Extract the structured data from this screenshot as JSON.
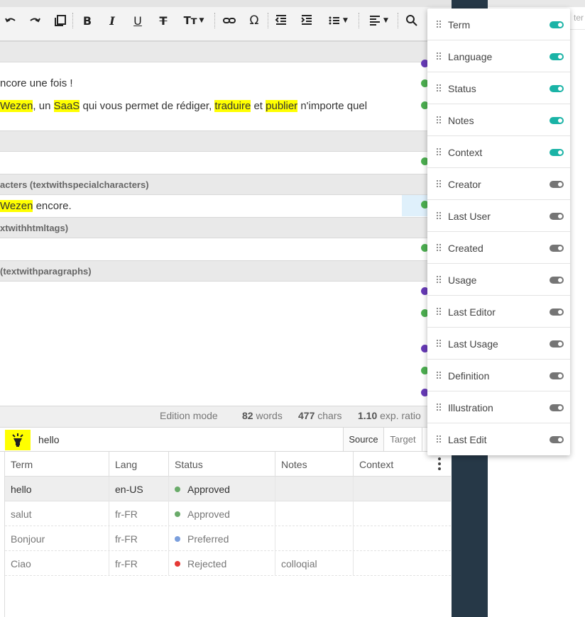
{
  "editor": {
    "line1": "ncore une fois !",
    "line2": {
      "parts": [
        "Wezen",
        ", un ",
        "SaaS",
        " qui vous permet de rédiger, ",
        "traduire",
        " et ",
        "publier",
        " n'importe quel"
      ]
    },
    "section_special": "acters (textwithspecialcharacters)",
    "line3": {
      "hl": "Wezen",
      "rest": " encore."
    },
    "section_html": "xtwithhtmltags)",
    "section_paragraphs": "(textwithparagraphs)"
  },
  "statusbar": {
    "mode": "Edition mode",
    "words_count": "82",
    "words_label": "words",
    "chars_count": "477",
    "chars_label": "chars",
    "ratio_value": "1.10",
    "ratio_label": "exp. ratio"
  },
  "search": {
    "value": "hello",
    "source_label": "Source",
    "target_label": "Target"
  },
  "table": {
    "headers": [
      "Term",
      "Lang",
      "Status",
      "Notes",
      "Context"
    ],
    "rows": [
      {
        "term": "hello",
        "lang": "en-US",
        "status": "Approved",
        "status_color": "#6aab6a",
        "notes": "",
        "context": ""
      },
      {
        "term": "salut",
        "lang": "fr-FR",
        "status": "Approved",
        "status_color": "#6aab6a",
        "notes": "",
        "context": ""
      },
      {
        "term": "Bonjour",
        "lang": "fr-FR",
        "status": "Preferred",
        "status_color": "#7b9fdd",
        "notes": "",
        "context": ""
      },
      {
        "term": "Ciao",
        "lang": "fr-FR",
        "status": "Rejected",
        "status_color": "#e53935",
        "notes": "colloqial",
        "context": ""
      }
    ]
  },
  "right_panel": {
    "partial_text": "ter"
  },
  "column_menu": {
    "items": [
      {
        "label": "Term",
        "enabled": true
      },
      {
        "label": "Language",
        "enabled": true
      },
      {
        "label": "Status",
        "enabled": true
      },
      {
        "label": "Notes",
        "enabled": true
      },
      {
        "label": "Context",
        "enabled": true
      },
      {
        "label": "Creator",
        "enabled": false
      },
      {
        "label": "Last User",
        "enabled": false
      },
      {
        "label": "Created",
        "enabled": false
      },
      {
        "label": "Usage",
        "enabled": false
      },
      {
        "label": "Last Editor",
        "enabled": false
      },
      {
        "label": "Last Usage",
        "enabled": false
      },
      {
        "label": "Definition",
        "enabled": false
      },
      {
        "label": "Illustration",
        "enabled": false
      },
      {
        "label": "Last Edit",
        "enabled": false
      }
    ]
  },
  "colors": {
    "highlight": "#ffff00",
    "toggle_on": "#1ab3a6",
    "toggle_off": "#757575",
    "dark_strip": "#263847",
    "dot_green": "#4caf50",
    "dot_purple": "#673ab7"
  }
}
